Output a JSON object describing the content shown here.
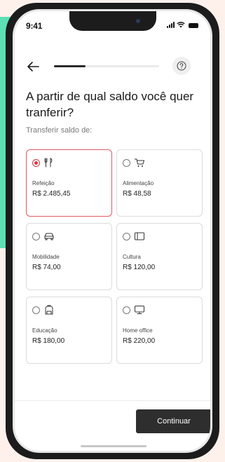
{
  "status_bar": {
    "time": "9:41"
  },
  "header": {
    "progress_fraction": 0.3
  },
  "title": "A partir de qual saldo você quer tranferir?",
  "subtitle": "Transferir saldo de:",
  "cards": [
    {
      "label": "Refeição",
      "value": "R$ 2.485,45",
      "icon": "fork-knife-icon",
      "selected": true
    },
    {
      "label": "Alimentação",
      "value": "R$ 48,58",
      "icon": "shopping-cart-icon",
      "selected": false
    },
    {
      "label": "Mobilidade",
      "value": "R$ 74,00",
      "icon": "car-icon",
      "selected": false
    },
    {
      "label": "Cultura",
      "value": "R$ 120,00",
      "icon": "ticket-icon",
      "selected": false
    },
    {
      "label": "Educação",
      "value": "R$ 180,00",
      "icon": "backpack-icon",
      "selected": false
    },
    {
      "label": "Home office",
      "value": "R$ 220,00",
      "icon": "monitor-icon",
      "selected": false
    }
  ],
  "footer": {
    "continue_label": "Continuar"
  },
  "colors": {
    "accent": "#e0343f",
    "selected_border": "#e05a63",
    "background_mint": "#5de0b5",
    "button_dark": "#2e2e2e"
  }
}
